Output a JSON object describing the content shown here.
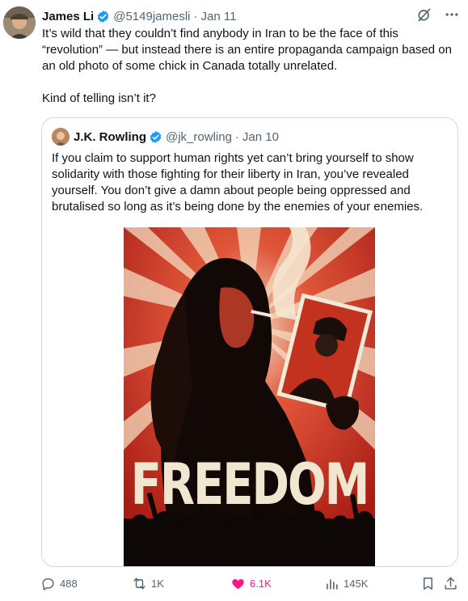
{
  "tweet": {
    "author_name": "James Li",
    "author_handle": "@5149jamesli",
    "separator": "·",
    "date": "Jan 11",
    "text_p1": "It’s wild that they couldn’t find anybody in Iran to be the face of this “revolution” — but instead there is an entire propaganda campaign based on an old photo of some chick in Canada totally unrelated.",
    "text_p2": "Kind of telling isn’t it?"
  },
  "quoted": {
    "author_name": "J.K. Rowling",
    "author_handle": "@jk_rowling",
    "separator": "·",
    "date": "Jan 10",
    "text": "If you claim to support human rights yet can’t bring yourself to show solidarity with those fighting for their liberty in Iran, you’ve revealed yourself. You don’t give a damn about people being oppressed and brutalised so long as it’s being done by the enemies of your enemies.",
    "poster_title": "FREEDOM"
  },
  "actions": {
    "replies": "488",
    "reposts": "1K",
    "likes": "6.1K",
    "views": "145K"
  },
  "icons": {
    "verified": "verified-badge-icon",
    "grok": "grok-icon",
    "more": "more-icon",
    "reply": "reply-icon",
    "repost": "repost-icon",
    "like": "heart-icon",
    "views": "views-icon",
    "bookmark": "bookmark-icon",
    "share": "share-icon"
  },
  "colors": {
    "verified_blue": "#1d9bf0",
    "like_pink": "#f91880",
    "secondary_text": "#536471",
    "poster_red": "#c8281e"
  }
}
